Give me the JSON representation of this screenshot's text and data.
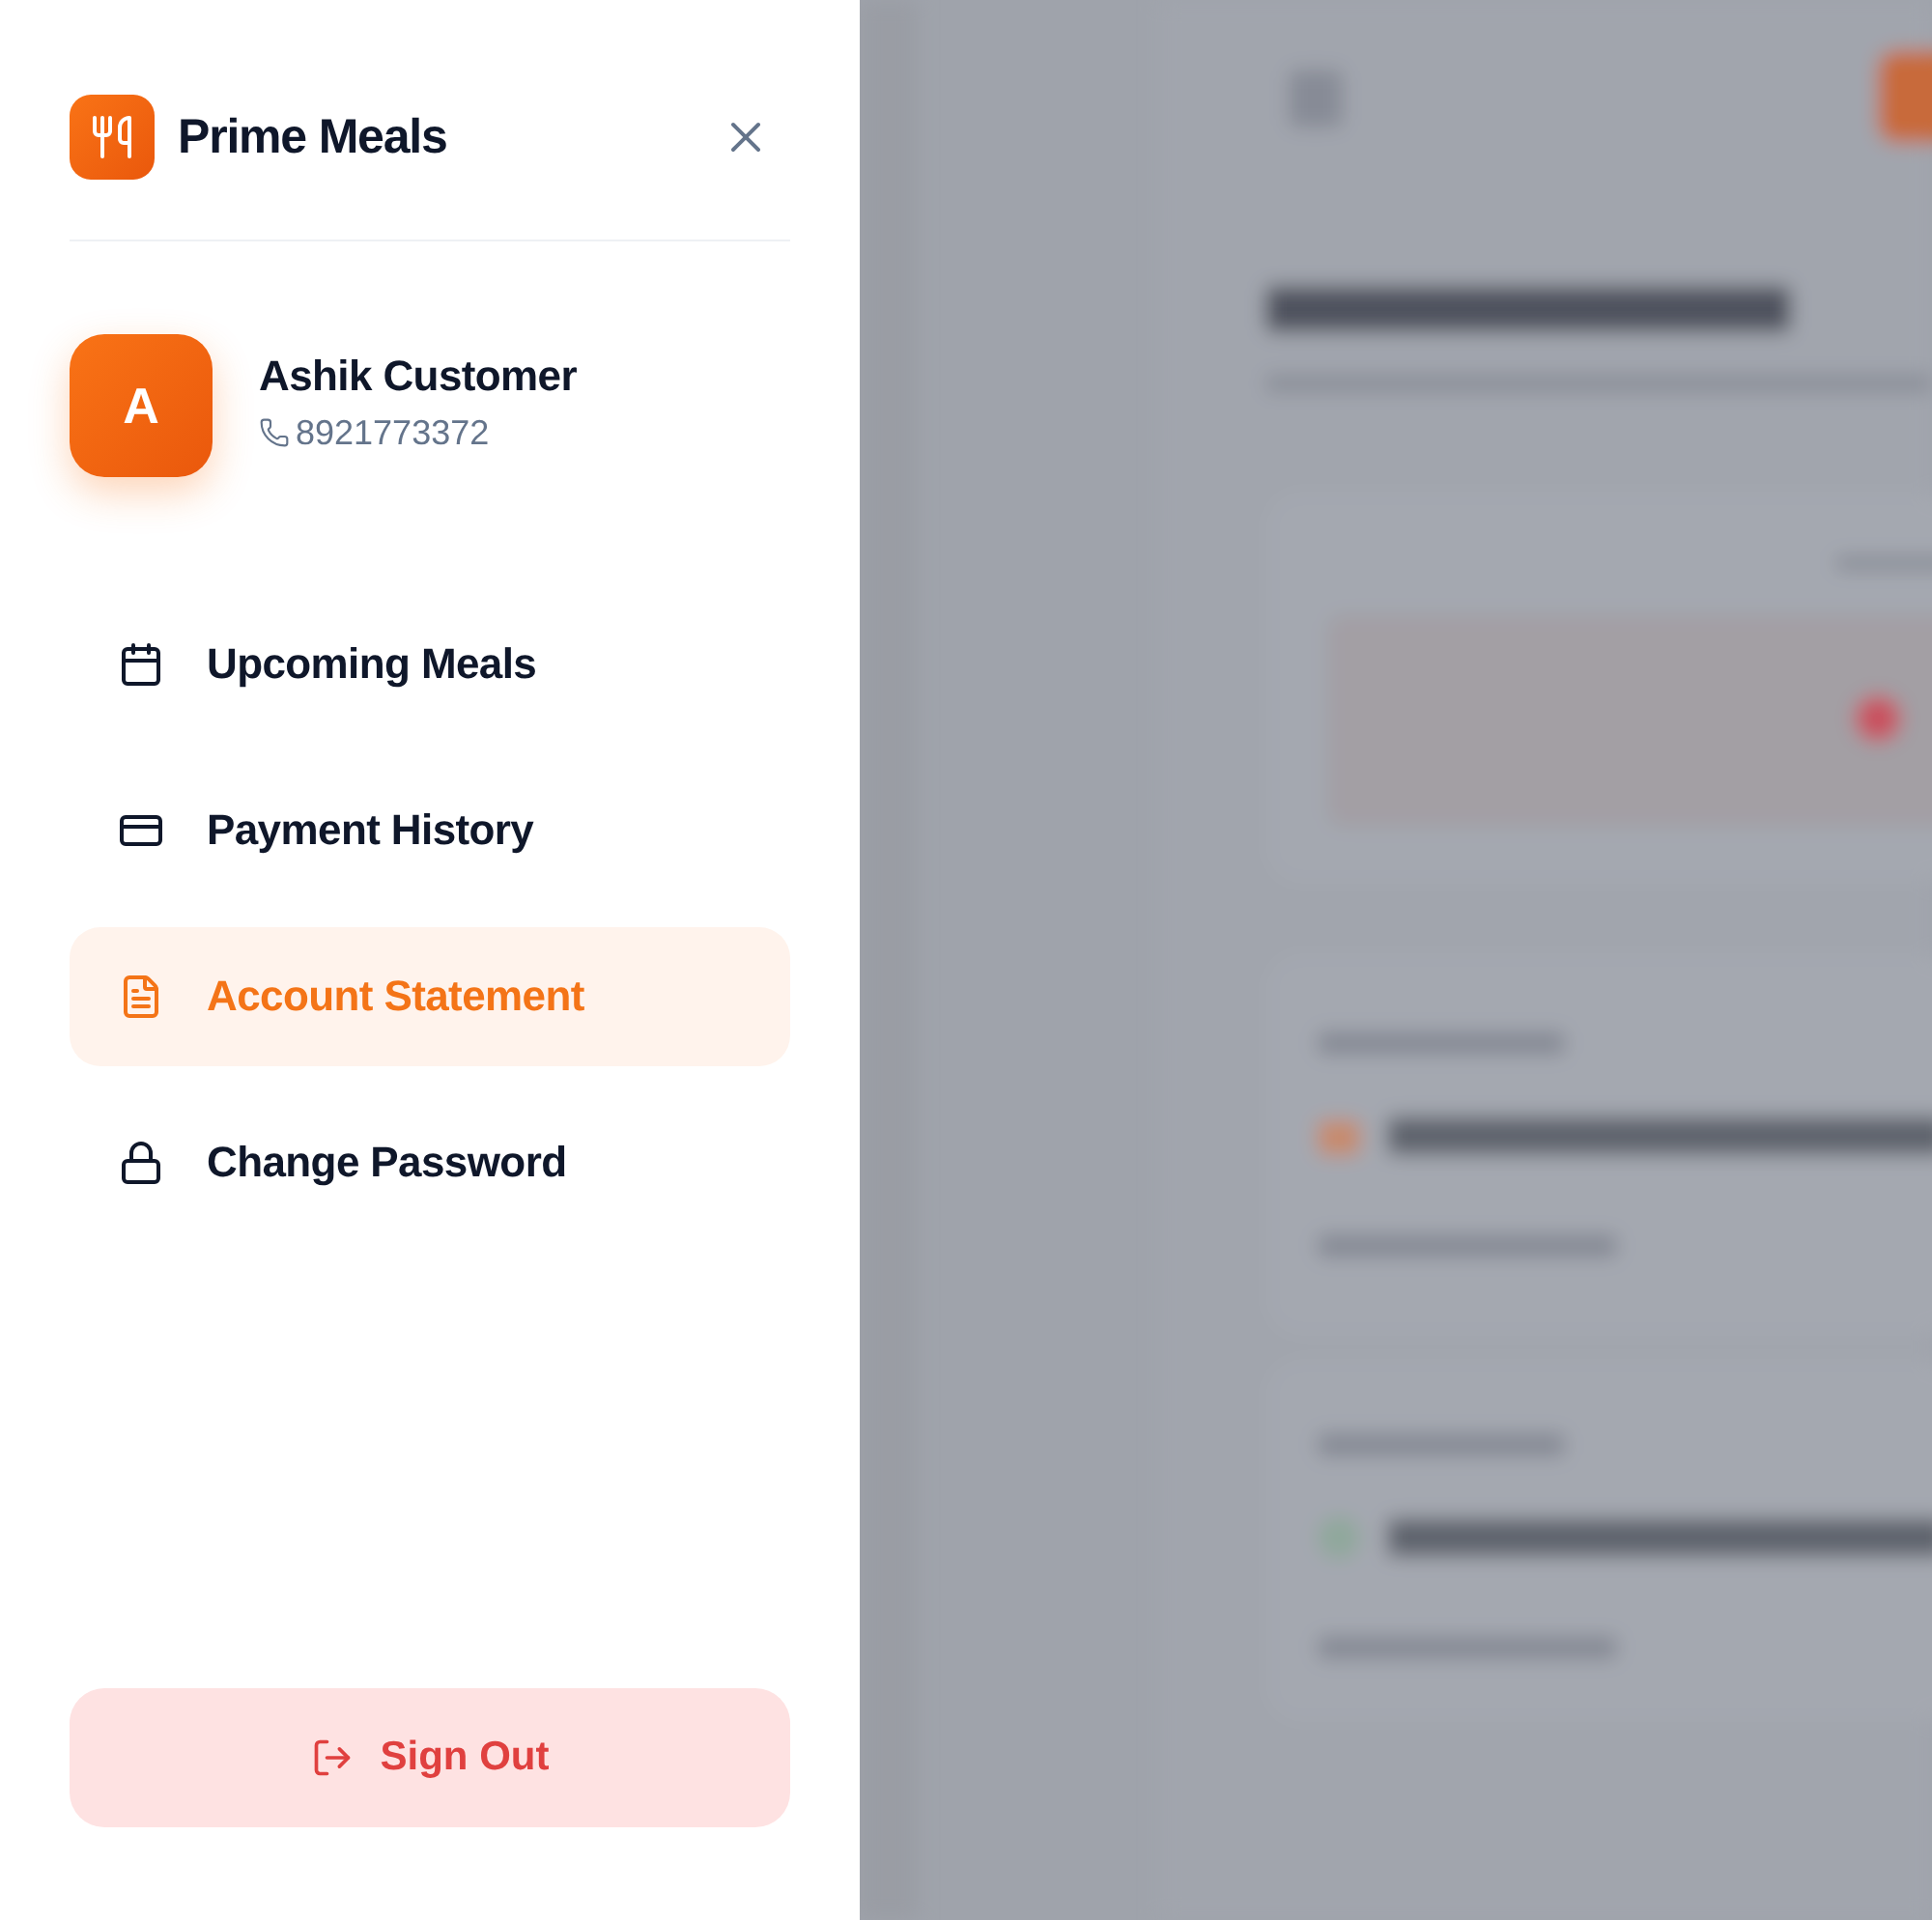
{
  "brand": {
    "name": "Prime Meals"
  },
  "profile": {
    "initial": "A",
    "name": "Ashik Customer",
    "phone": "8921773372"
  },
  "nav": [
    {
      "kind": "calendar",
      "label": "Upcoming Meals",
      "selected": false
    },
    {
      "kind": "card",
      "label": "Payment History",
      "selected": false
    },
    {
      "kind": "document",
      "label": "Account Statement",
      "selected": true
    },
    {
      "kind": "lock",
      "label": "Change Password",
      "selected": false
    }
  ],
  "sign_out": {
    "label": "Sign Out"
  }
}
